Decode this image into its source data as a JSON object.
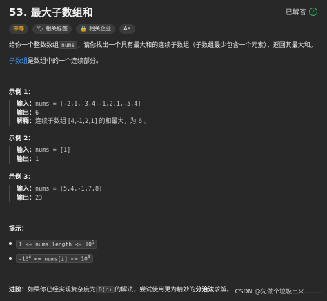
{
  "problem": {
    "title": "53. 最大子数组和",
    "status": "已解答"
  },
  "tags": [
    {
      "label": "中等",
      "icon": "difficulty"
    },
    {
      "label": "相关标签",
      "icon": "tag-icon"
    },
    {
      "label": "相关企业",
      "icon": "lock-icon"
    },
    {
      "label": "Aa",
      "icon": "font-icon"
    }
  ],
  "desc": {
    "part1": "给你一个整数数组",
    "code": "nums",
    "part2": "，请你找出一个具有最大和的连续子数组（子数组最少包含一个元素），返回其最大和。",
    "link": "子数组",
    "link_rest": "是数组中的一个连续部分。"
  },
  "examples": [
    {
      "title": "示例 1：",
      "input_label": "输入：",
      "input": "nums = [-2,1,-3,4,-1,2,1,-5,4]",
      "output_label": "输出：",
      "output": "6",
      "expl_label": "解释：",
      "expl": "连续子数组 [4,-1,2,1] 的和最大，为 6 。"
    },
    {
      "title": "示例 2：",
      "input_label": "输入：",
      "input": "nums = [1]",
      "output_label": "输出：",
      "output": "1"
    },
    {
      "title": "示例 3：",
      "input_label": "输入：",
      "input": "nums = [5,4,-1,7,8]",
      "output_label": "输出：",
      "output": "23"
    }
  ],
  "constraints": {
    "title": "提示：",
    "c1": {
      "text": "1 <= nums.length <= 10",
      "sup": "5"
    },
    "c2": {
      "text1": "-10",
      "sup1": "4",
      "text2": " <= nums[i] <= 10",
      "sup2": "4"
    }
  },
  "followup": {
    "label": "进阶：",
    "part1": "如果你已经实现复杂度为",
    "code": "O(n)",
    "part2": "的解法，尝试使用更为精妙的",
    "bold": "分治法",
    "part3": "求解。"
  },
  "watermark": "CSDN @先做个垃圾出来………"
}
